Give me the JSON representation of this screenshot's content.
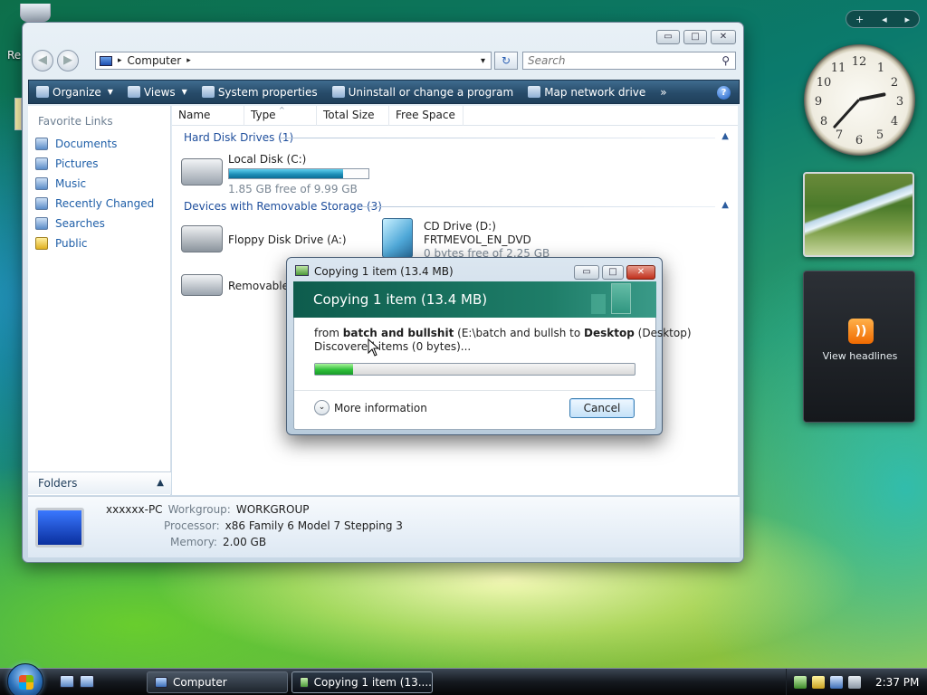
{
  "desktop": {
    "icon_label_partial": "Re"
  },
  "explorer": {
    "caption_buttons": {
      "minimize": "▭",
      "maximize": "□",
      "close": "✕"
    },
    "nav": {
      "back": "◀",
      "forward": "▶"
    },
    "address": {
      "path": "Computer",
      "sep": "▸",
      "dropdown": "▾"
    },
    "refresh_symbol": "↻",
    "search_placeholder": "Search",
    "search_icon": "⚲",
    "toolbar": {
      "organize": "Organize",
      "views": "Views",
      "system_properties": "System properties",
      "uninstall": "Uninstall or change a program",
      "map_network": "Map network drive",
      "more": "»",
      "help": "?"
    },
    "left_pane": {
      "title": "Favorite Links",
      "items": [
        "Documents",
        "Pictures",
        "Music",
        "Recently Changed",
        "Searches",
        "Public"
      ],
      "folders_label": "Folders",
      "folders_chevron": "▲"
    },
    "columns": [
      "Name",
      "Type",
      "Total Size",
      "Free Space"
    ],
    "sort_indicator": "^",
    "groups": {
      "hard_disks": "Hard Disk Drives (1)",
      "removable": "Devices with Removable Storage (3)",
      "collapse": "▲"
    },
    "drives": {
      "local": {
        "name": "Local Disk (C:)",
        "free": "1.85 GB free of 9.99 GB",
        "used_fraction": 0.815
      },
      "floppy": {
        "name": "Floppy Disk Drive (A:)"
      },
      "cd": {
        "name": "CD Drive (D:)",
        "label": "FRTMEVOL_EN_DVD",
        "free": "0 bytes free of 2.25 GB"
      },
      "removable": {
        "name": "Removable D"
      }
    },
    "details": {
      "computer_name": "xxxxxx-PC",
      "workgroup_label": "Workgroup:",
      "workgroup": "WORKGROUP",
      "processor_label": "Processor:",
      "processor": "x86 Family 6 Model 7 Stepping 3",
      "memory_label": "Memory:",
      "memory": "2.00 GB"
    }
  },
  "dialog": {
    "title": "Copying 1 item (13.4 MB)",
    "heading": "Copying 1 item (13.4 MB)",
    "from_prefix": "from",
    "from_name": "batch and bullshit",
    "from_path": "(E:\\batch and bullsh",
    "to_prefix": "to",
    "to_name": "Desktop",
    "to_path": "(Desktop)",
    "discovered": "Discovered",
    "discovered_rest": "items (0 bytes)...",
    "progress": 0.12,
    "more_info": "More information",
    "more_info_chevron": "⌄",
    "cancel": "Cancel",
    "caption_buttons": {
      "minimize": "▭",
      "maximize": "□",
      "close": "✕"
    }
  },
  "gadgets": {
    "bar": {
      "add": "+",
      "prev": "◂",
      "next": "▸"
    },
    "clock_numbers": [
      "12",
      "1",
      "2",
      "3",
      "4",
      "5",
      "6",
      "7",
      "8",
      "9",
      "10",
      "11"
    ],
    "clock_time": {
      "hour": 2,
      "minute": 37
    },
    "feeds_label": "View headlines",
    "rss_symbol": "))"
  },
  "taskbar": {
    "tasks": [
      "Computer",
      "Copying 1 item (13...."
    ],
    "time": "2:37 PM"
  }
}
